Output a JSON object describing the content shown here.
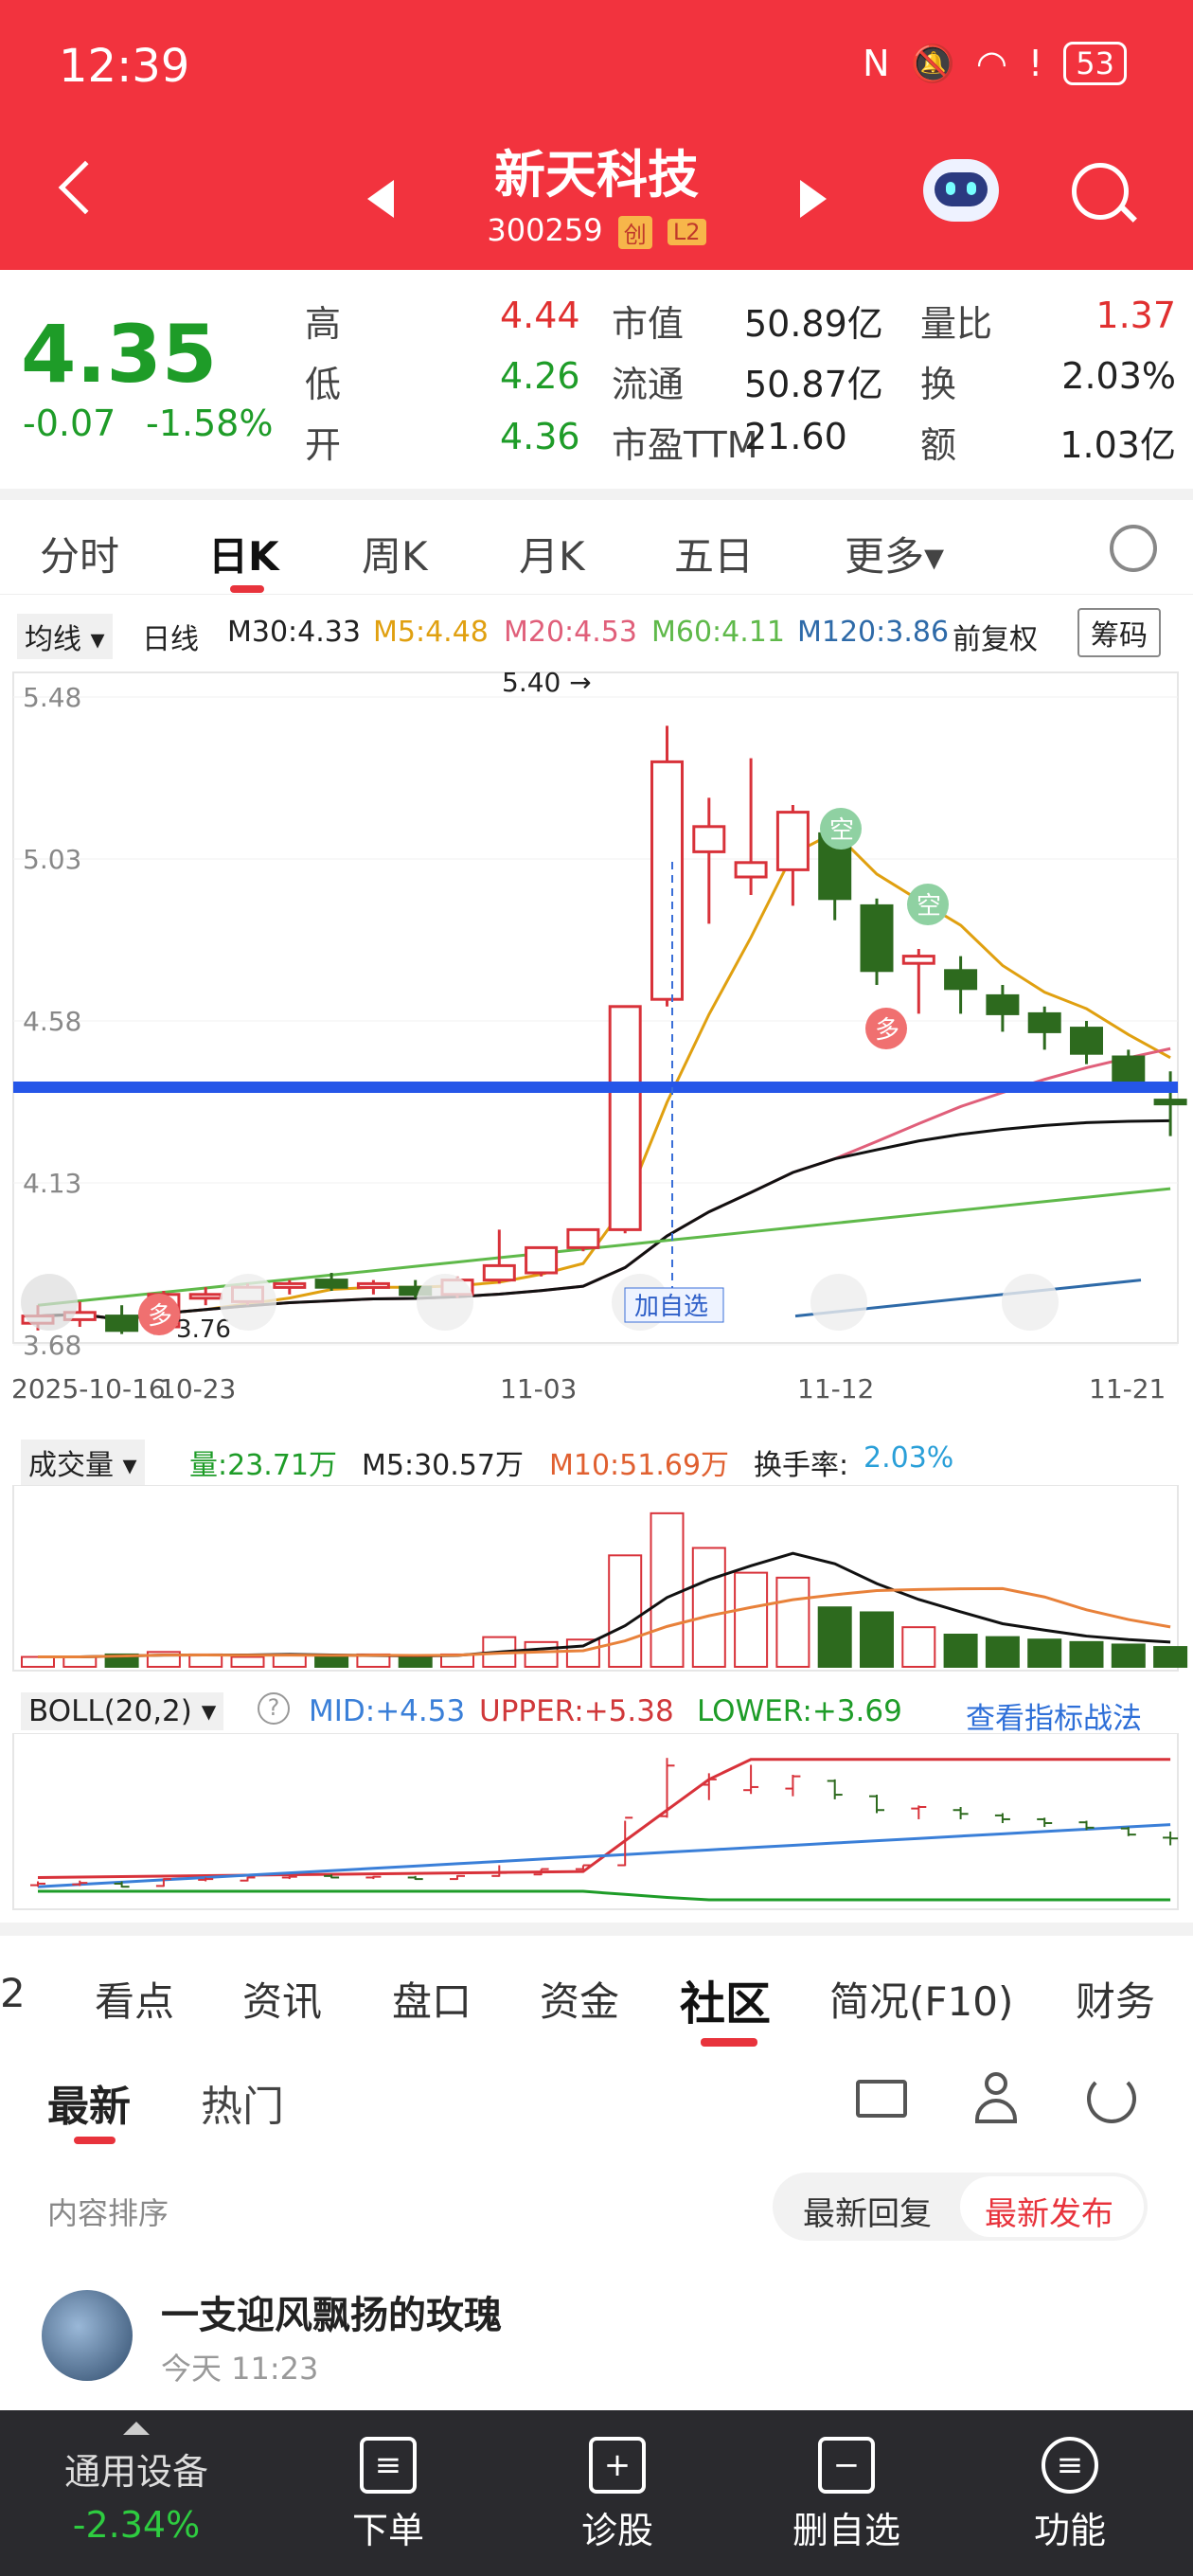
{
  "status_bar": {
    "time": "12:39",
    "battery": "53"
  },
  "header": {
    "name": "新天科技",
    "code": "300259",
    "tag1": "创",
    "tag2": "L2"
  },
  "quote": {
    "price": "4.35",
    "change": "-0.07",
    "change_pct": "-1.58%",
    "high_label": "高",
    "high": "4.44",
    "low_label": "低",
    "low": "4.26",
    "open_label": "开",
    "open": "4.36",
    "mcap_label": "市值",
    "mcap": "50.89亿",
    "float_label": "流通",
    "float": "50.87亿",
    "pe_label": "市盈TTM",
    "pe": "21.60",
    "vr_label": "量比",
    "vr": "1.37",
    "turn_label": "换",
    "turn": "2.03%",
    "amt_label": "额",
    "amt": "1.03亿"
  },
  "ktabs": [
    "分时",
    "日K",
    "周K",
    "月K",
    "五日",
    "更多▾"
  ],
  "ma_row": {
    "selector": "均线 ▾",
    "period": "日线",
    "m30": "M30:4.33",
    "m5": "M5:4.48",
    "m20": "M20:4.53",
    "m60": "M60:4.11",
    "m120": "M120:3.86",
    "adj": "前复权",
    "chip": "筹码"
  },
  "chart_data": {
    "type": "candlestick",
    "y_ticks": [
      "5.48",
      "5.03",
      "4.58",
      "4.13",
      "3.68"
    ],
    "x_ticks": [
      "2025-10-16",
      "10-23",
      "11-03",
      "11-12",
      "11-21"
    ],
    "max_label": "5.40",
    "min_label": "3.76",
    "candles": [
      {
        "o": 3.74,
        "h": 3.79,
        "l": 3.72,
        "c": 3.76
      },
      {
        "o": 3.75,
        "h": 3.8,
        "l": 3.73,
        "c": 3.77
      },
      {
        "o": 3.76,
        "h": 3.79,
        "l": 3.71,
        "c": 3.72
      },
      {
        "o": 3.73,
        "h": 3.83,
        "l": 3.72,
        "c": 3.82
      },
      {
        "o": 3.81,
        "h": 3.84,
        "l": 3.79,
        "c": 3.82
      },
      {
        "o": 3.8,
        "h": 3.85,
        "l": 3.79,
        "c": 3.84
      },
      {
        "o": 3.84,
        "h": 3.86,
        "l": 3.82,
        "c": 3.85
      },
      {
        "o": 3.86,
        "h": 3.88,
        "l": 3.83,
        "c": 3.84
      },
      {
        "o": 3.84,
        "h": 3.86,
        "l": 3.82,
        "c": 3.85
      },
      {
        "o": 3.84,
        "h": 3.86,
        "l": 3.81,
        "c": 3.82
      },
      {
        "o": 3.82,
        "h": 3.87,
        "l": 3.81,
        "c": 3.86
      },
      {
        "o": 3.86,
        "h": 4.0,
        "l": 3.85,
        "c": 3.9
      },
      {
        "o": 3.88,
        "h": 3.95,
        "l": 3.87,
        "c": 3.95
      },
      {
        "o": 3.95,
        "h": 4.0,
        "l": 3.94,
        "c": 4.0
      },
      {
        "o": 4.0,
        "h": 4.58,
        "l": 3.99,
        "c": 4.62
      },
      {
        "o": 4.64,
        "h": 5.4,
        "l": 4.62,
        "c": 5.3
      },
      {
        "o": 5.05,
        "h": 5.2,
        "l": 4.85,
        "c": 5.12
      },
      {
        "o": 4.98,
        "h": 5.31,
        "l": 4.93,
        "c": 5.02
      },
      {
        "o": 5.0,
        "h": 5.18,
        "l": 4.9,
        "c": 5.16
      },
      {
        "o": 5.1,
        "h": 5.12,
        "l": 4.86,
        "c": 4.92
      },
      {
        "o": 4.9,
        "h": 4.92,
        "l": 4.68,
        "c": 4.72
      },
      {
        "o": 4.74,
        "h": 4.78,
        "l": 4.6,
        "c": 4.76
      },
      {
        "o": 4.72,
        "h": 4.76,
        "l": 4.6,
        "c": 4.67
      },
      {
        "o": 4.65,
        "h": 4.68,
        "l": 4.55,
        "c": 4.6
      },
      {
        "o": 4.6,
        "h": 4.62,
        "l": 4.5,
        "c": 4.55
      },
      {
        "o": 4.56,
        "h": 4.58,
        "l": 4.46,
        "c": 4.49
      },
      {
        "o": 4.48,
        "h": 4.5,
        "l": 4.38,
        "c": 4.4
      },
      {
        "o": 4.36,
        "h": 4.44,
        "l": 4.26,
        "c": 4.35
      }
    ],
    "volume": {
      "label": "成交量 ▾",
      "vol": "量:23.71万",
      "m5": "M5:30.57万",
      "m10": "M10:51.69万",
      "turnover_label": "换手率:",
      "turnover": "2.03%"
    },
    "boll": {
      "label": "BOLL(20,2) ▾",
      "mid": "MID:+4.53",
      "upper": "UPPER:+5.38",
      "lower": "LOWER:+3.69",
      "link": "查看指标战法"
    }
  },
  "bottom_tabs": [
    "2",
    "看点",
    "资讯",
    "盘口",
    "资金",
    "社区",
    "简况(F10)",
    "财务"
  ],
  "sub_tabs": {
    "latest": "最新",
    "hot": "热门"
  },
  "sort": {
    "label": "内容排序",
    "reply": "最新回复",
    "publish": "最新发布"
  },
  "post": {
    "user": "一支迎风飘扬的玫瑰",
    "time": "今天 11:23"
  },
  "bottom_bar": {
    "sector": "通用设备",
    "sector_pct": "-2.34%",
    "order": "下单",
    "diag": "诊股",
    "remove": "删自选",
    "func": "功能"
  },
  "chart_labels": {
    "add_watch": "加自选",
    "duo": "多",
    "kong": "空"
  }
}
